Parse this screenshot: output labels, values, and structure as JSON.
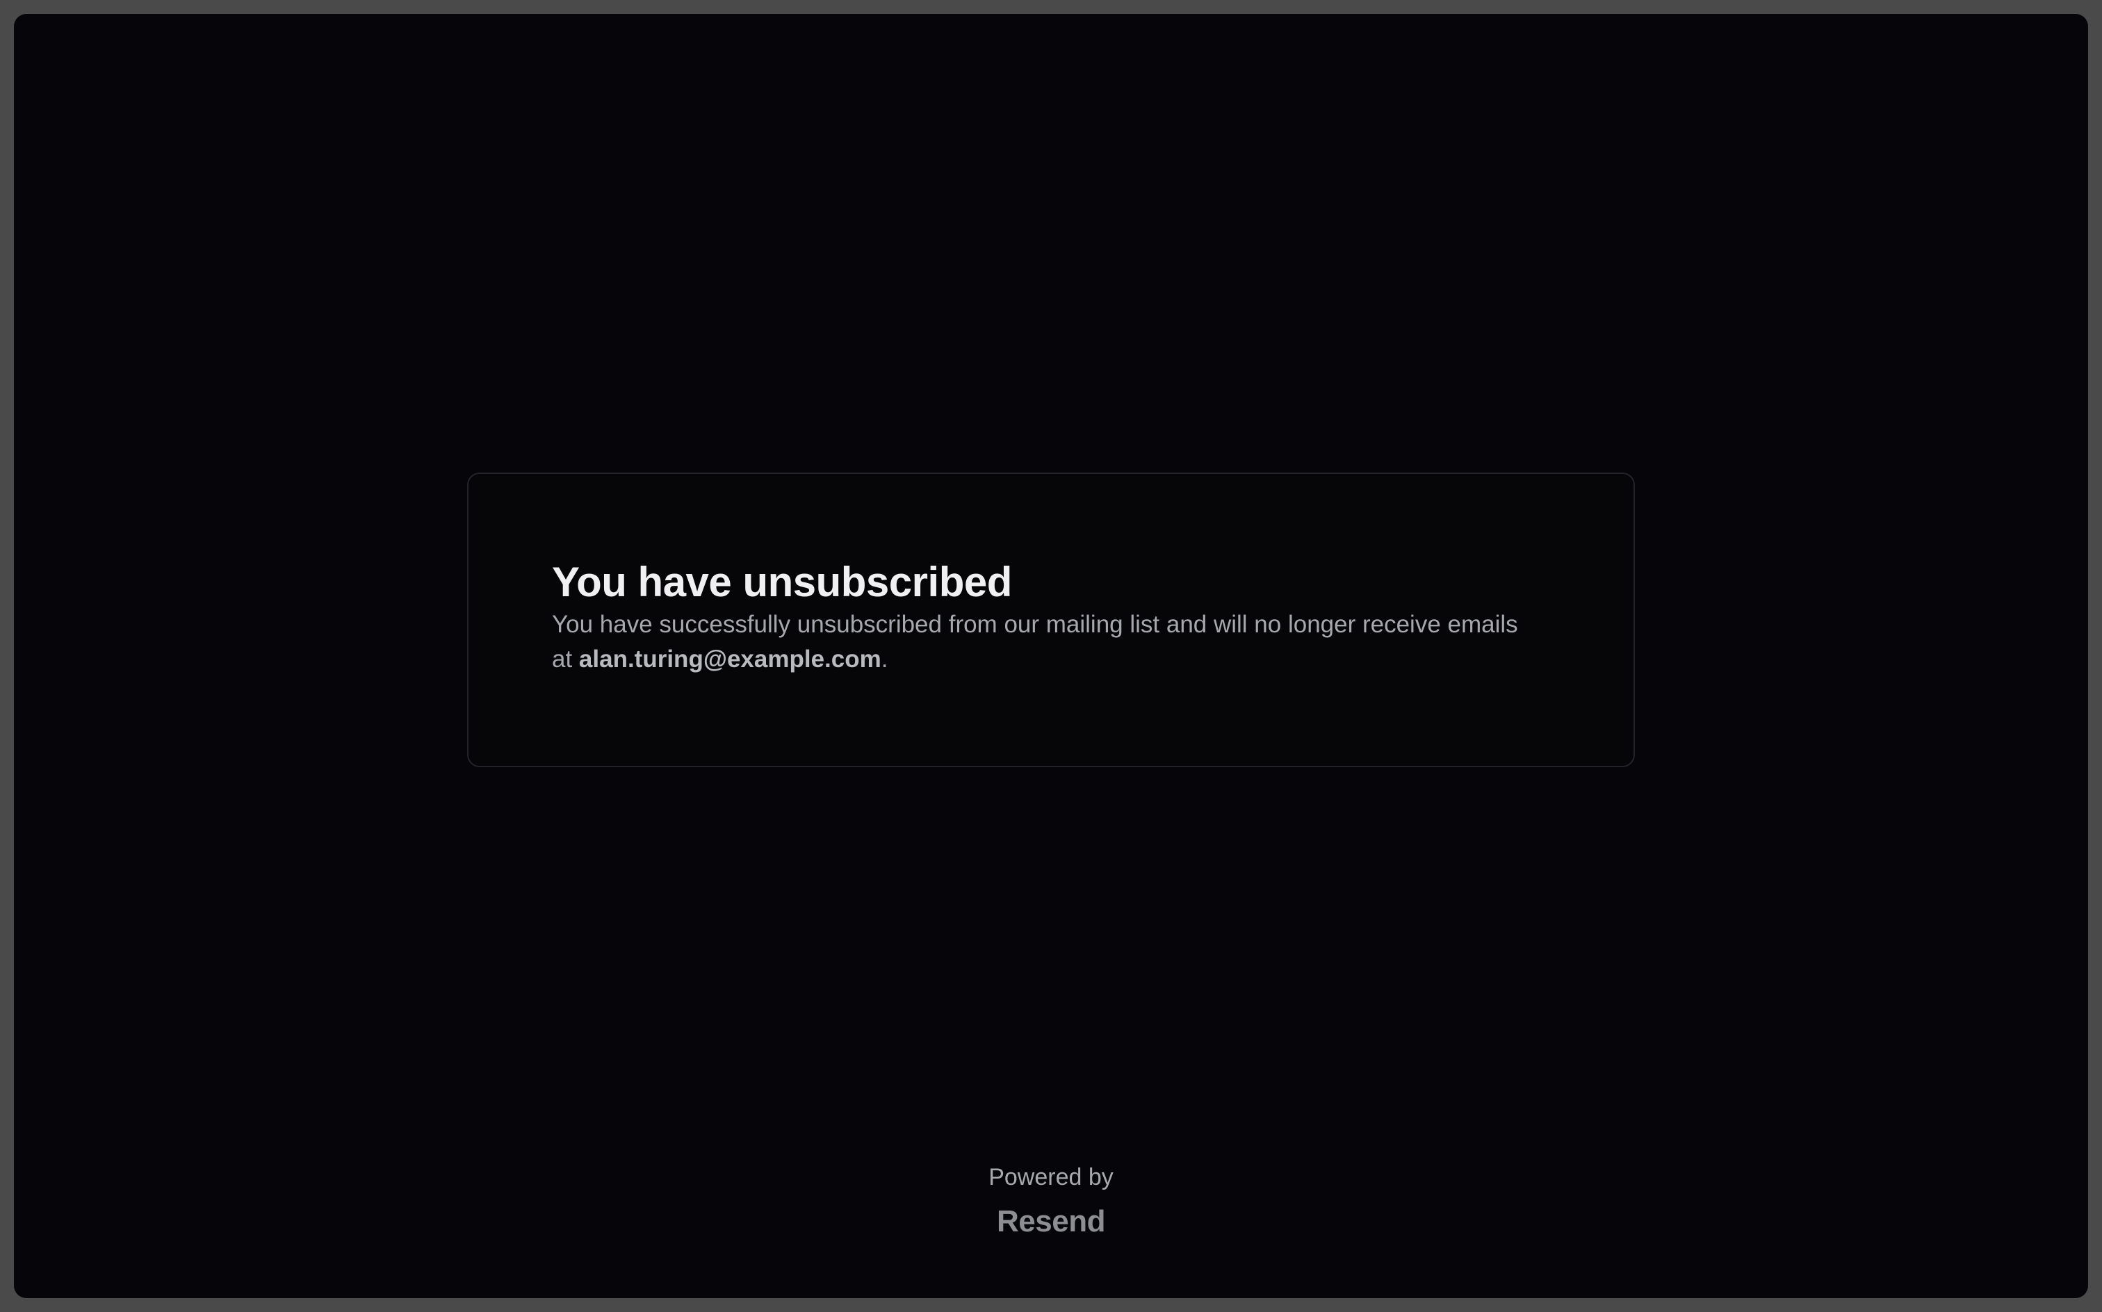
{
  "unsubscribe": {
    "title": "You have unsubscribed",
    "description_prefix": "You have successfully unsubscribed from our mailing list and will no longer receive emails at ",
    "email": "alan.turing@example.com",
    "description_suffix": "."
  },
  "footer": {
    "powered_by": "Powered by",
    "brand": "Resend"
  },
  "colors": {
    "background": "#05050a",
    "frame": "#4a4a4a",
    "card_border": "#23242a",
    "title": "#f0f0f2",
    "text": "#a6a8ad"
  }
}
